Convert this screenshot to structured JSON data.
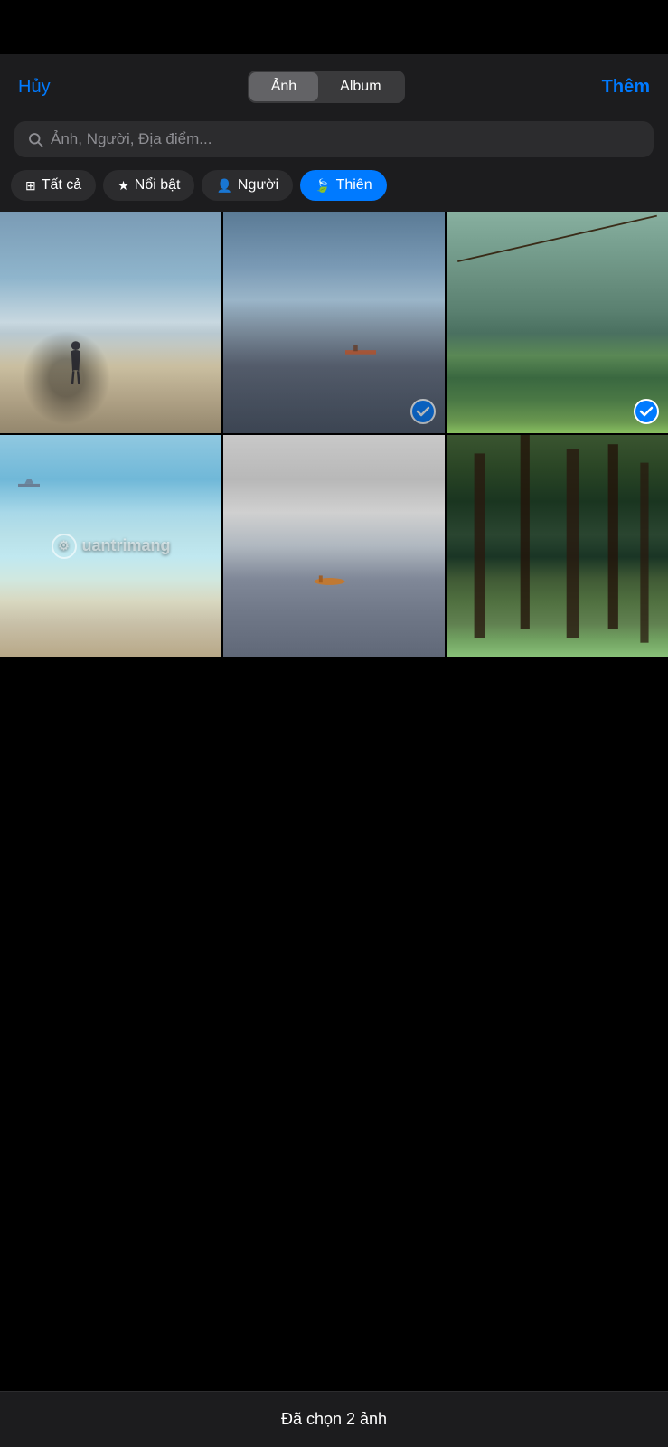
{
  "header": {
    "cancel_label": "Hủy",
    "add_label": "Thêm",
    "segment": {
      "options": [
        "Ảnh",
        "Album"
      ],
      "active": "Ảnh"
    }
  },
  "search": {
    "placeholder": "Ảnh, Người, Địa điểm..."
  },
  "filters": [
    {
      "id": "all",
      "icon": "grid",
      "label": "Tất cả",
      "active": false
    },
    {
      "id": "featured",
      "icon": "star",
      "label": "Nổi bật",
      "active": false
    },
    {
      "id": "people",
      "icon": "person",
      "label": "Người",
      "active": false
    },
    {
      "id": "nature",
      "icon": "leaf",
      "label": "Thiên",
      "active": true
    }
  ],
  "photos": [
    {
      "id": 1,
      "selected": false,
      "class": "photo-1"
    },
    {
      "id": 2,
      "selected": true,
      "class": "photo-2"
    },
    {
      "id": 3,
      "selected": true,
      "class": "photo-3"
    },
    {
      "id": 4,
      "selected": false,
      "class": "photo-4"
    },
    {
      "id": 5,
      "selected": false,
      "class": "photo-5"
    },
    {
      "id": 6,
      "selected": false,
      "class": "photo-6"
    }
  ],
  "watermark": {
    "text": "uantrimang"
  },
  "bottom": {
    "label": "Đã chọn 2 ảnh"
  }
}
